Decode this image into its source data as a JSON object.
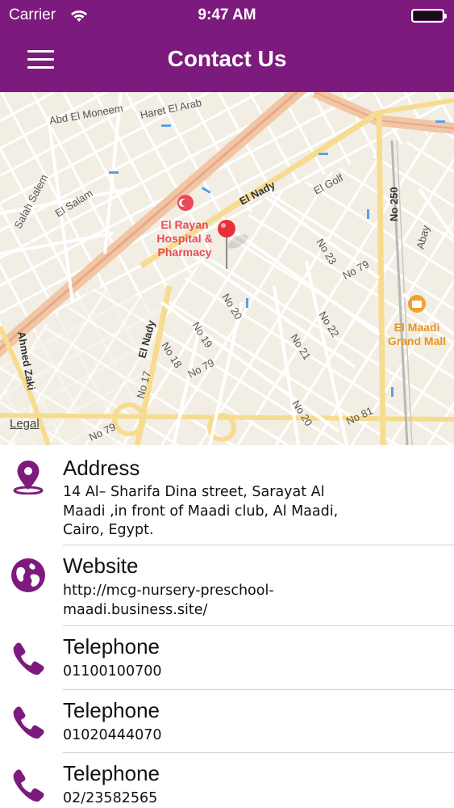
{
  "status_bar": {
    "carrier": "Carrier",
    "time": "9:47 AM"
  },
  "header": {
    "title": "Contact Us"
  },
  "map": {
    "legal": "Legal",
    "labels": {
      "abd_el_moneem": "Abd El Moneem",
      "haret_el_arab": "Haret El Arab",
      "salah_salem": "Salah Salem",
      "el_salam": "El Salam",
      "el_nady_top": "El Nady",
      "el_golf": "El Golf",
      "no_250": "No 250",
      "abay": "Abay",
      "hospital_1": "El Rayan",
      "hospital_2": "Hospital &",
      "hospital_3": "Pharmacy",
      "no_23": "No 23",
      "no_79_a": "No 79",
      "no_20_a": "No 20",
      "no_19": "No 19",
      "no_18": "No 18",
      "no_79_b": "No 79",
      "no_21": "No 21",
      "no_22": "No 22",
      "el_nady_left": "El Nady",
      "no_17": "No 17",
      "ahmed_zaki": "Ahmed Zaki",
      "mall_1": "El Maadi",
      "mall_2": "Grand Mall",
      "no_79_c": "No 79",
      "no_20_b": "No 20",
      "no_81": "No 81"
    }
  },
  "contacts": [
    {
      "label": "Address",
      "icon": "location-pin-icon",
      "lines": [
        "14 Al– Sharifa Dina street, Sarayat Al",
        "Maadi ,in front of Maadi club, Al Maadi,",
        "Cairo, Egypt."
      ]
    },
    {
      "label": "Website",
      "icon": "globe-icon",
      "lines": [
        "http://mcg-nursery-preschool-",
        "maadi.business.site/"
      ]
    },
    {
      "label": "Telephone",
      "icon": "phone-icon",
      "lines": [
        "01100100700"
      ]
    },
    {
      "label": "Telephone",
      "icon": "phone-icon",
      "lines": [
        "01020444070"
      ]
    },
    {
      "label": "Telephone",
      "icon": "phone-icon",
      "lines": [
        "02/23582565"
      ]
    }
  ],
  "colors": {
    "brand": "#7d1a7d",
    "icon": "#7d1a7d",
    "pin": "#e8303a",
    "mall": "#f0a030",
    "hospital": "#e84a5a"
  }
}
